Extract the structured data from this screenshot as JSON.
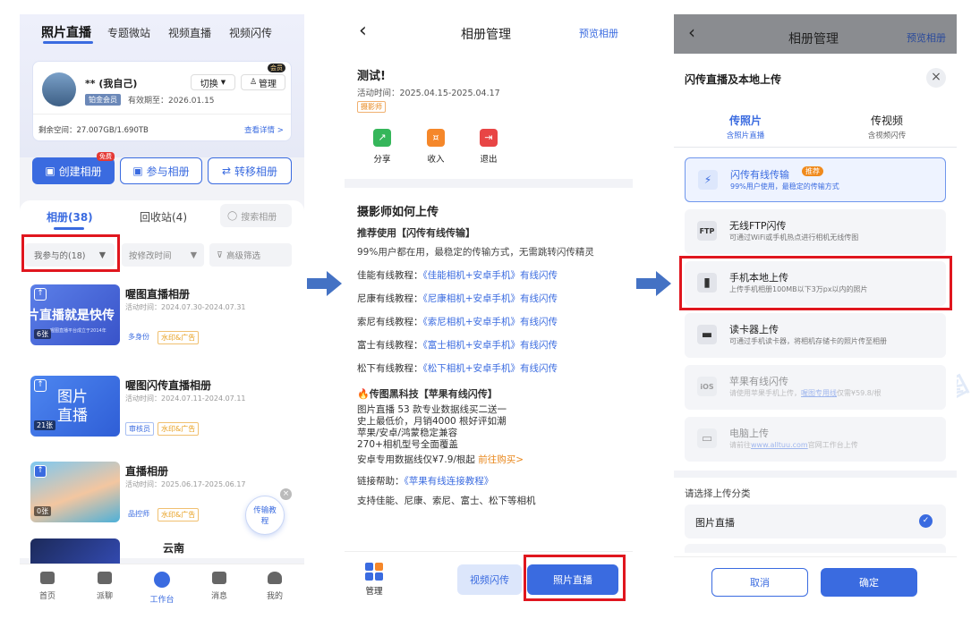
{
  "p1": {
    "tabs": [
      "照片直播",
      "专题微站",
      "视频直播",
      "视频闪传"
    ],
    "user": {
      "name": "** (我自己)",
      "vip": "会员",
      "switch": "切换",
      "manage": "管理",
      "level": "铂金会员",
      "expiry": "有效期至：2026.01.15",
      "space": "剩余空间：27.007GB/1.690TB",
      "details": "查看详情 >"
    },
    "buttons": {
      "create": "创建相册",
      "create_badge": "免费",
      "join": "参与相册",
      "transfer": "转移相册"
    },
    "list_tabs": {
      "albums": "相册(38)",
      "recycle": "回收站(4)",
      "search": "搜索相册"
    },
    "filters": {
      "participated": "我参与的(18)",
      "sort": "按修改时间",
      "advanced": "高级筛选"
    },
    "albums": [
      {
        "title": "喔图直播相册",
        "date": "活动时间：2024.07.30-2024.07.31",
        "count": "6张",
        "thumb_text": "片直播就是快传",
        "thumb_sub": "喔图直播平台成立于2014年",
        "tag1": "多身份",
        "tag2": "水印&广告"
      },
      {
        "title": "喔图闪传直播相册",
        "date": "活动时间：2024.07.11-2024.07.11",
        "count": "21张",
        "thumb_text": "图片直播",
        "tag1": "审核员",
        "tag2": "水印&广告"
      },
      {
        "title": "直播相册",
        "date": "活动时间：2025.06.17-2025.06.17",
        "count": "0张",
        "tag1": "品控师",
        "tag2": "水印&广告"
      },
      {
        "title": "云南"
      }
    ],
    "float_button": "传输教程",
    "nav": [
      "首页",
      "派聊",
      "工作台",
      "消息",
      "我的"
    ]
  },
  "p2": {
    "back": "‹",
    "title": "相册管理",
    "preview": "预览相册",
    "album_name": "测试!",
    "date": "活动时间：2025.04.15-2025.04.17",
    "role": "摄影师",
    "actions": [
      "分享",
      "收入",
      "退出"
    ],
    "section_title": "摄影师如何上传",
    "recommend": "推荐使用【闪传有线传输】",
    "desc": "99%用户都在用，最稳定的传输方式，无需跳转闪传精灵",
    "tutorials": [
      {
        "label": "佳能有线教程：",
        "link": "《佳能相机+安卓手机》有线闪传"
      },
      {
        "label": "尼康有线教程：",
        "link": "《尼康相机+安卓手机》有线闪传"
      },
      {
        "label": "索尼有线教程：",
        "link": "《索尼相机+安卓手机》有线闪传"
      },
      {
        "label": "富士有线教程：",
        "link": "《富士相机+安卓手机》有线闪传"
      },
      {
        "label": "松下有线教程：",
        "link": "《松下相机+安卓手机》有线闪传"
      }
    ],
    "apple_title": "🔥传图黑科技【苹果有线闪传】",
    "apple_lines": [
      "图片直播 53 款专业数据线买二送一",
      "史上最低价，月销4000 根好评如潮",
      "苹果/安卓/鸿蒙稳定兼容",
      "270+相机型号全面覆盖"
    ],
    "price_line": "安卓专用数据线仅¥7.9/根起",
    "buy": "前往购买>",
    "help_label": "链接帮助：",
    "help_link": "《苹果有线连接教程》",
    "support": "支持佳能、尼康、索尼、富士、松下等相机",
    "bottom": {
      "manage": "管理",
      "video": "视频闪传",
      "photo": "照片直播"
    }
  },
  "p3": {
    "header_title": "相册管理",
    "header_preview": "预览相册",
    "sheet_title": "闪传直播及本地上传",
    "close": "×",
    "tab_photo": "传照片",
    "tab_photo_sub": "含照片直播",
    "tab_video": "传视频",
    "tab_video_sub": "含视频闪传",
    "options": [
      {
        "icon": "⚡",
        "title": "闪传有线传输",
        "badge": "推荐",
        "sub": "99%用户使用，最稳定的传输方式"
      },
      {
        "icon": "FTP",
        "title": "无线FTP闪传",
        "sub": "可通过WiFi或手机热点进行相机无线传图"
      },
      {
        "icon": "▮",
        "title": "手机本地上传",
        "sub": "上传手机相册100MB以下3万px以内的照片"
      },
      {
        "icon": "▬",
        "title": "读卡器上传",
        "sub": "可通过手机读卡器，将相机存储卡的照片传至相册"
      },
      {
        "icon": "iOS",
        "title": "苹果有线闪传",
        "sub_pre": "请使用苹果手机上传，",
        "sub_link": "喔图专用线",
        "sub_post": "仅需¥59.8/根"
      },
      {
        "icon": "▭",
        "title": "电脑上传",
        "sub_pre": "请前往",
        "sub_link": "www.alltuu.com",
        "sub_post": "官网工作台上传"
      }
    ],
    "category_label": "请选择上传分类",
    "category": "图片直播",
    "cancel": "取消",
    "confirm": "确定"
  },
  "colors": {
    "accent": "#3a6be0",
    "highlight": "#e0161e",
    "orange": "#f08a1c"
  },
  "watermark": "喔图"
}
